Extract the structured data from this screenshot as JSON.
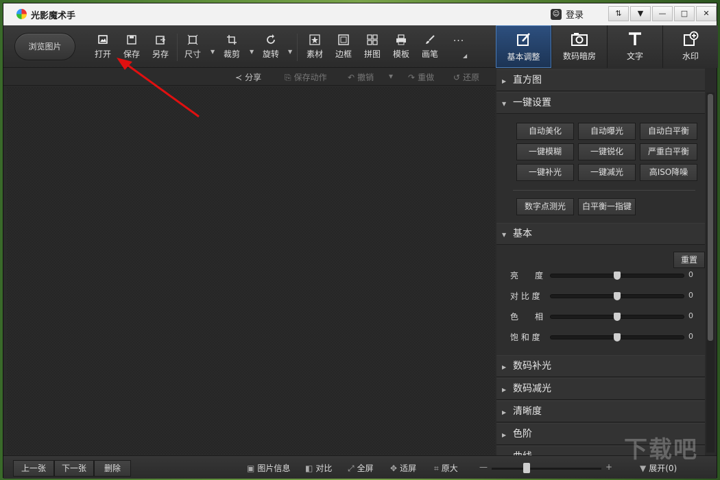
{
  "app": {
    "title": "光影魔术手",
    "login_label": "登录"
  },
  "window_controls": [
    "⇅",
    "▼",
    "—",
    "□",
    "✕"
  ],
  "toolbar": {
    "browse_label": "浏览图片",
    "open": "打开",
    "save": "保存",
    "save_as": "另存",
    "size": "尺寸",
    "crop": "裁剪",
    "rotate": "旋转",
    "material": "素材",
    "border": "边框",
    "collage": "拼图",
    "template": "模板",
    "brush": "画笔",
    "more": "..."
  },
  "right_tabs": [
    "基本调整",
    "数码暗房",
    "文字",
    "水印"
  ],
  "subbar": {
    "share": "分享",
    "save_action": "保存动作",
    "undo": "撤销",
    "redo": "重做",
    "restore": "还原"
  },
  "panel": {
    "histogram": "直方图",
    "one_click": "一键设置",
    "presets": [
      "自动美化",
      "自动曝光",
      "自动白平衡",
      "一键模糊",
      "一键锐化",
      "严重白平衡",
      "一键补光",
      "一键减光",
      "高ISO降噪",
      "数字点测光",
      "白平衡一指键"
    ],
    "basic": "基本",
    "reset": "重置",
    "sliders": [
      {
        "label": "亮　　度",
        "value": "0"
      },
      {
        "label": "对 比 度",
        "value": "0"
      },
      {
        "label": "色　　相",
        "value": "0"
      },
      {
        "label": "饱 和 度",
        "value": "0"
      }
    ],
    "sections": [
      "数码补光",
      "数码减光",
      "清晰度",
      "色阶",
      "曲线"
    ]
  },
  "bottom": {
    "prev": "上一张",
    "next": "下一张",
    "delete": "删除",
    "info": "图片信息",
    "compare": "对比",
    "fullscreen": "全屏",
    "fit": "适屏",
    "original": "原大",
    "zoom_minus": "—",
    "zoom_plus": "+",
    "expand": "展开(0)"
  },
  "watermark": "下载吧",
  "annotation_color": "#e01010"
}
